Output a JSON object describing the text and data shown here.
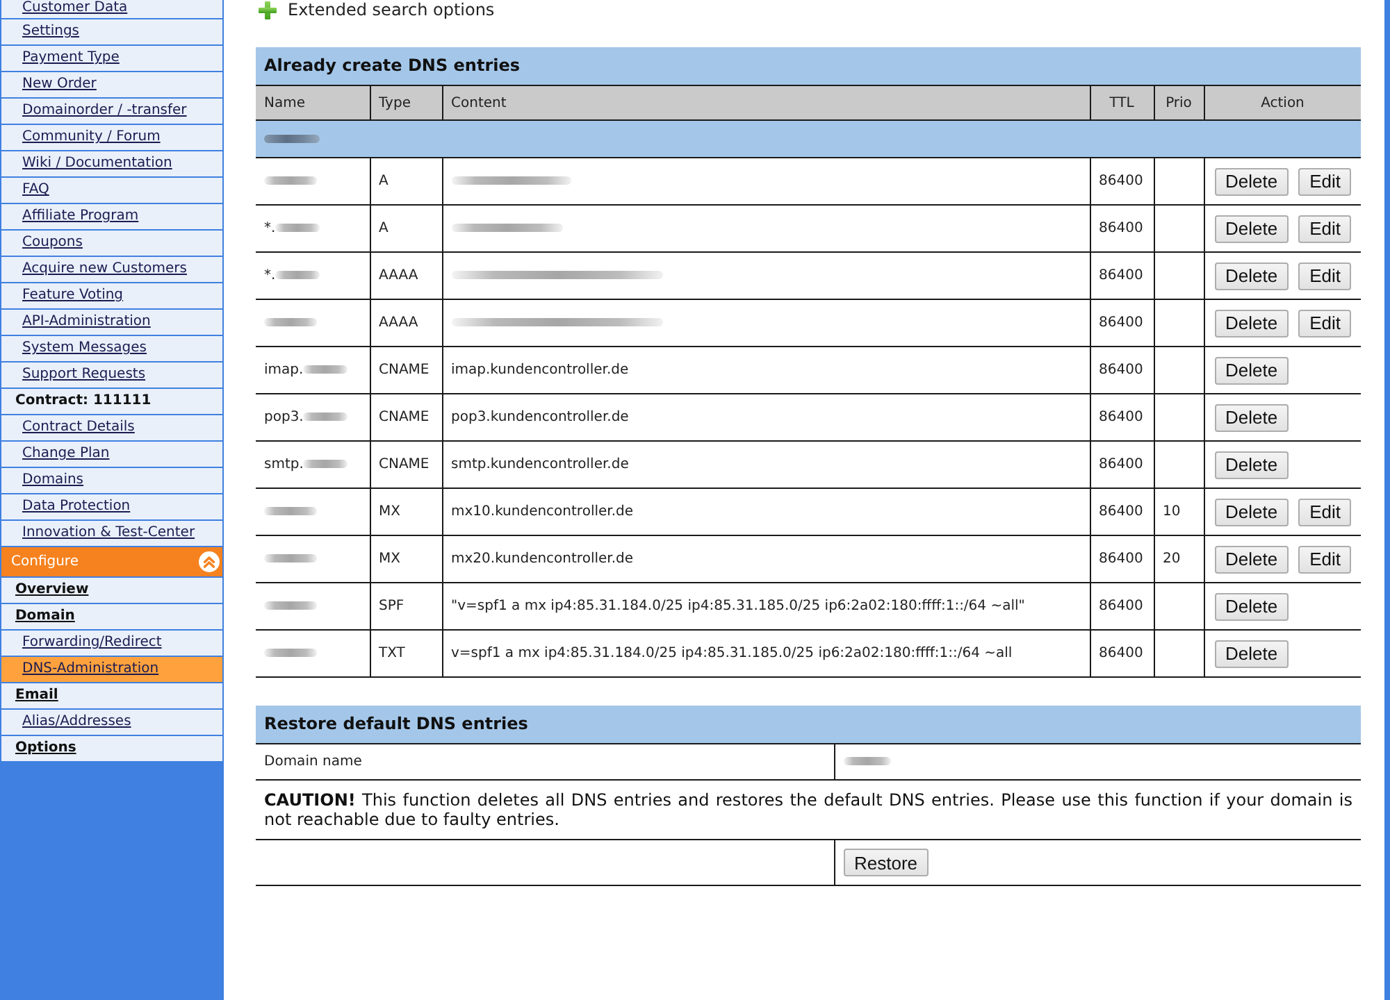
{
  "sidebar": {
    "items": [
      {
        "label": "Customer Data",
        "kind": "link",
        "selected": false
      },
      {
        "label": "Settings",
        "kind": "link",
        "selected": false
      },
      {
        "label": "Payment Type",
        "kind": "link",
        "selected": false
      },
      {
        "label": "New Order",
        "kind": "link",
        "selected": false
      },
      {
        "label": "Domainorder / -transfer",
        "kind": "link",
        "selected": false
      },
      {
        "label": "Community / Forum",
        "kind": "link",
        "selected": false
      },
      {
        "label": "Wiki / Documentation",
        "kind": "link",
        "selected": false
      },
      {
        "label": "FAQ",
        "kind": "link",
        "selected": false
      },
      {
        "label": "Affiliate Program",
        "kind": "link",
        "selected": false
      },
      {
        "label": "Coupons",
        "kind": "link",
        "selected": false
      },
      {
        "label": "Acquire new Customers",
        "kind": "link",
        "selected": false
      },
      {
        "label": "Feature Voting",
        "kind": "link",
        "selected": false
      },
      {
        "label": "API-Administration",
        "kind": "link",
        "selected": false
      },
      {
        "label": "System Messages",
        "kind": "link",
        "selected": false
      },
      {
        "label": "Support Requests",
        "kind": "link",
        "selected": false
      },
      {
        "label": "Contract: 111111",
        "kind": "heading",
        "selected": false
      },
      {
        "label": "Contract Details",
        "kind": "link",
        "selected": false
      },
      {
        "label": "Change Plan",
        "kind": "link",
        "selected": false
      },
      {
        "label": "Domains",
        "kind": "link",
        "selected": false
      },
      {
        "label": "Data Protection",
        "kind": "link",
        "selected": false
      },
      {
        "label": "Innovation & Test-Center",
        "kind": "link",
        "selected": false
      }
    ],
    "section": {
      "label": "Configure",
      "expanded": true,
      "items": [
        {
          "label": "Overview",
          "kind": "group",
          "selected": false
        },
        {
          "label": "Domain",
          "kind": "group",
          "selected": false
        },
        {
          "label": "Forwarding/Redirect",
          "kind": "link",
          "selected": false
        },
        {
          "label": "DNS-Administration",
          "kind": "link",
          "selected": true
        },
        {
          "label": "Email",
          "kind": "group",
          "selected": false
        },
        {
          "label": "Alias/Addresses",
          "kind": "link",
          "selected": false
        },
        {
          "label": "Options",
          "kind": "group",
          "selected": false
        }
      ]
    }
  },
  "search": {
    "label": "Extended search options",
    "expanded": false
  },
  "dns_table": {
    "title": "Already create DNS entries",
    "columns": [
      "Name",
      "Type",
      "Content",
      "TTL",
      "Prio",
      "Action"
    ],
    "domain_row": {
      "name_blurred": true
    },
    "rows": [
      {
        "name_blurred": true,
        "type": "A",
        "content_blurred": true,
        "ttl": "86400",
        "actions": [
          "Delete",
          "Edit"
        ]
      },
      {
        "name": "*.",
        "name_blurred": true,
        "type": "A",
        "content_blurred": true,
        "ttl": "86400",
        "actions": [
          "Delete",
          "Edit"
        ]
      },
      {
        "name": "*.",
        "name_blurred": true,
        "type": "AAAA",
        "content_blurred": true,
        "ttl": "86400",
        "actions": [
          "Delete",
          "Edit"
        ]
      },
      {
        "name_blurred": true,
        "type": "AAAA",
        "content_blurred": true,
        "ttl": "86400",
        "actions": [
          "Delete",
          "Edit"
        ]
      },
      {
        "name": "imap.",
        "name_blurred": true,
        "type": "CNAME",
        "content": "imap.kundencontroller.de",
        "ttl": "86400",
        "actions": [
          "Delete"
        ]
      },
      {
        "name": "pop3.",
        "name_blurred": true,
        "type": "CNAME",
        "content": "pop3.kundencontroller.de",
        "ttl": "86400",
        "actions": [
          "Delete"
        ]
      },
      {
        "name": "smtp.",
        "name_blurred": true,
        "type": "CNAME",
        "content": "smtp.kundencontroller.de",
        "ttl": "86400",
        "actions": [
          "Delete"
        ]
      },
      {
        "name_blurred": true,
        "type": "MX",
        "content": "mx10.kundencontroller.de",
        "ttl": "86400",
        "prio": "10",
        "actions": [
          "Delete",
          "Edit"
        ]
      },
      {
        "name_blurred": true,
        "type": "MX",
        "content": "mx20.kundencontroller.de",
        "ttl": "86400",
        "prio": "20",
        "actions": [
          "Delete",
          "Edit"
        ]
      },
      {
        "name_blurred": true,
        "type": "SPF",
        "content": "\"v=spf1 a mx ip4:85.31.184.0/25 ip4:85.31.185.0/25 ip6:2a02:180:ffff:1::/64 ~all\"",
        "ttl": "86400",
        "actions": [
          "Delete"
        ]
      },
      {
        "name_blurred": true,
        "type": "TXT",
        "content": "v=spf1 a mx ip4:85.31.184.0/25 ip4:85.31.185.0/25 ip6:2a02:180:ffff:1::/64 ~all",
        "ttl": "86400",
        "actions": [
          "Delete"
        ]
      }
    ]
  },
  "restore": {
    "title": "Restore default DNS entries",
    "domain_label": "Domain name",
    "domain_blurred": true,
    "caution": "**CAUTION!** This function deletes all DNS entries and restores the default DNS entries. Please use this function if your domain is not reachable due to faulty entries.",
    "button": "Restore"
  }
}
